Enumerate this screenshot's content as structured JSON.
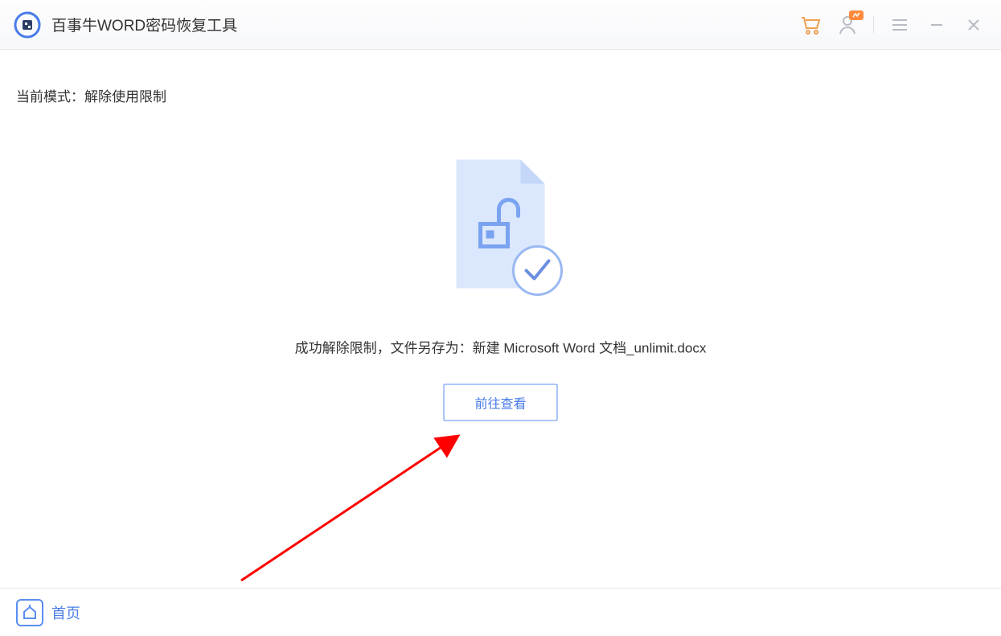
{
  "app": {
    "title": "百事牛WORD密码恢复工具"
  },
  "titlebar": {
    "cart_icon": "cart-icon",
    "user_icon": "user-icon",
    "menu_icon": "menu-icon",
    "minimize_icon": "minimize-icon",
    "close_icon": "close-icon"
  },
  "mode": {
    "label": "当前模式：解除使用限制"
  },
  "result": {
    "message": "成功解除限制，文件另存为：新建 Microsoft Word 文档_unlimit.docx",
    "go_view_button": "前往查看"
  },
  "footer": {
    "home_label": "首页"
  },
  "colors": {
    "accent": "#4a7ce8",
    "cart": "#f0a050",
    "icon_muted": "#b8bcc4",
    "doc_light": "#dbe7fc",
    "doc_lock": "#7aa3f0",
    "arrow": "#ff0000"
  }
}
